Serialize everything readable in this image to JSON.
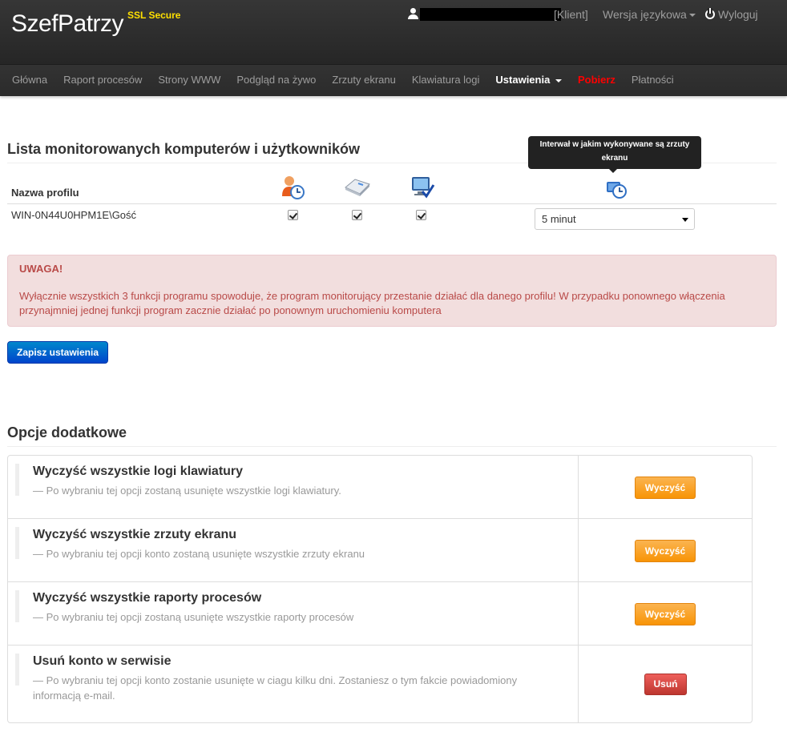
{
  "brand": {
    "name": "SzefPatrzy",
    "ssl": "SSL Secure"
  },
  "usernav": {
    "client": "[Klient]",
    "language": "Wersja językowa",
    "logout": "Wyloguj"
  },
  "nav": {
    "items": [
      "Główna",
      "Raport procesów",
      "Strony WWW",
      "Podgląd na żywo",
      "Zrzuty ekranu",
      "Klawiatura logi"
    ],
    "settings": "Ustawienia",
    "download": "Pobierz",
    "payments": "Płatności"
  },
  "monitor": {
    "title": "Lista monitorowanych komputerów i użytkowników",
    "tooltip": "Interwał w jakim wykonywane są zrzuty ekranu",
    "col_profile": "Nazwa profilu",
    "icons": [
      "user-clock-icon",
      "keyboard-icon",
      "monitor-check-icon",
      "clock-monitor-icon"
    ],
    "rows": [
      {
        "profile": "WIN-0N44U0HPM1E\\Gość",
        "processes": true,
        "keyboard": true,
        "screenshots": true,
        "interval": "5 minut"
      }
    ]
  },
  "alert": {
    "title": "UWAGA!",
    "message": "Wyłącznie wszystkich 3 funkcji programu spowoduje, że program monitorujący przestanie działać dla danego profilu! W przypadku ponownego włączenia przynajmniej jednej funkcji program zacznie działać po ponownym uruchomieniu komputera"
  },
  "save_label": "Zapisz ustawienia",
  "options": {
    "title": "Opcje dodatkowe",
    "rows": [
      {
        "title": "Wyczyść wszystkie logi klawiatury",
        "desc": "— Po wybraniu tej opcji zostaną usunięte wszystkie logi klawiatury.",
        "button": "Wyczyść"
      },
      {
        "title": "Wyczyść wszystkie zrzuty ekranu",
        "desc": "— Po wybraniu tej opcji konto zostaną usunięte wszystkie zrzuty ekranu",
        "button": "Wyczyść"
      },
      {
        "title": "Wyczyść wszystkie raporty procesów",
        "desc": "— Po wybraniu tej opcji zostaną usunięte wszystkie raporty procesów",
        "button": "Wyczyść"
      },
      {
        "title": "Usuń konto w serwisie",
        "desc": "— Po wybraniu tej opcji konto zostanie usunięte w ciagu kilku dni. Zostaniesz o tym fakcie powiadomiony informacją e-mail.",
        "button": "Usuń"
      }
    ]
  },
  "colors": {
    "accent_blue": "#0066cc",
    "warning_orange": "#f89406",
    "danger_red": "#bd362f",
    "alert_bg": "#f2dede",
    "download_red": "#ff0000"
  }
}
